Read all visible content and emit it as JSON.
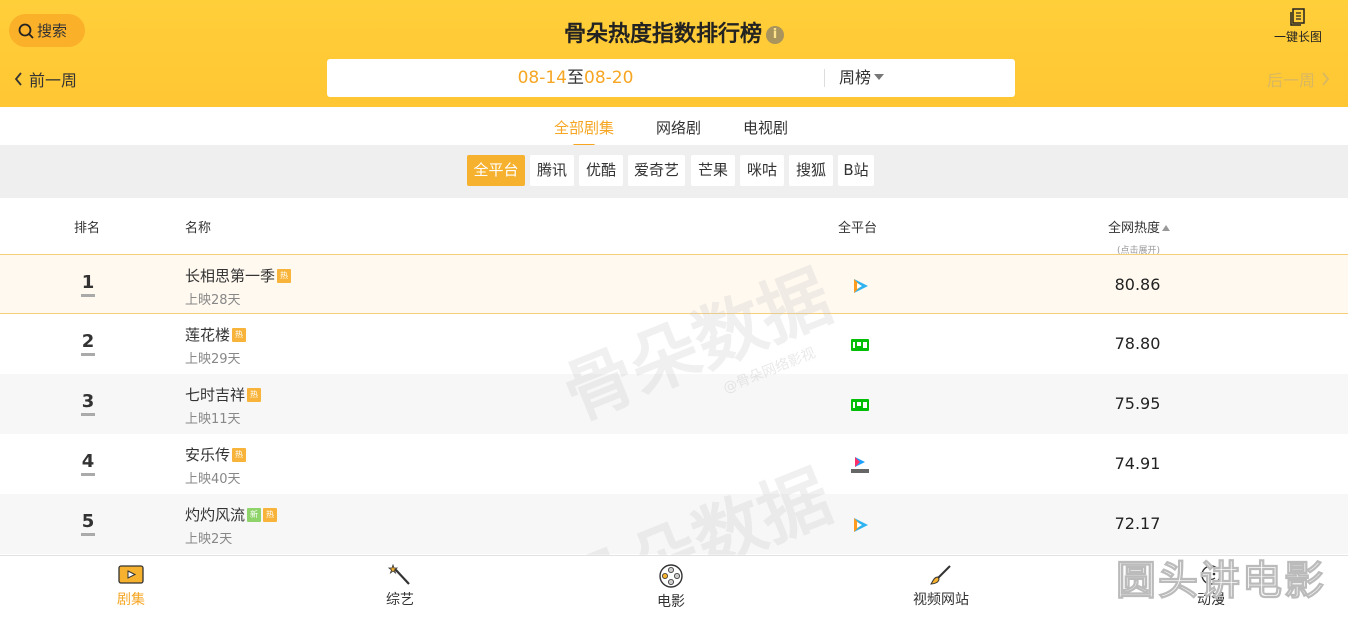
{
  "header": {
    "search_label": "搜索",
    "title": "骨朵热度指数排行榜",
    "info_icon": "info-icon",
    "long_image_label": "一键长图",
    "prev_week": "前一周",
    "next_week": "后一周",
    "date_start": "08-14",
    "date_sep": "至",
    "date_end": "08-20",
    "period_select": "周榜"
  },
  "category_tabs": [
    {
      "label": "全部剧集",
      "active": true
    },
    {
      "label": "网络剧",
      "active": false
    },
    {
      "label": "电视剧",
      "active": false
    }
  ],
  "platforms": [
    {
      "label": "全平台",
      "active": true
    },
    {
      "label": "腾讯"
    },
    {
      "label": "优酷"
    },
    {
      "label": "爱奇艺"
    },
    {
      "label": "芒果"
    },
    {
      "label": "咪咕"
    },
    {
      "label": "搜狐"
    },
    {
      "label": "B站"
    }
  ],
  "table": {
    "col_rank": "排名",
    "col_name": "名称",
    "col_platform": "全平台",
    "col_heat": "全网热度",
    "col_heat_sub": "(点击展开)",
    "rows": [
      {
        "rank": "1",
        "name": "长相思第一季",
        "badges": [
          "热"
        ],
        "days": "上映28天",
        "platform": "tencent-icon",
        "score": "80.86"
      },
      {
        "rank": "2",
        "name": "莲花楼",
        "badges": [
          "热"
        ],
        "days": "上映29天",
        "platform": "iqiyi-icon",
        "score": "78.80"
      },
      {
        "rank": "3",
        "name": "七时吉祥",
        "badges": [
          "热"
        ],
        "days": "上映11天",
        "platform": "iqiyi-icon",
        "score": "75.95"
      },
      {
        "rank": "4",
        "name": "安乐传",
        "badges": [
          "热"
        ],
        "days": "上映40天",
        "platform": "youku-icon",
        "score": "74.91"
      },
      {
        "rank": "5",
        "name": "灼灼风流",
        "badges": [
          "新",
          "热"
        ],
        "days": "上映2天",
        "platform": "tencent-icon",
        "score": "72.17"
      }
    ]
  },
  "watermark": {
    "text": "骨朵数据",
    "sub": "@骨朵网络影视"
  },
  "bottom_nav": [
    {
      "label": "剧集",
      "icon": "tv-icon",
      "active": true
    },
    {
      "label": "综艺",
      "icon": "magic-wand-icon"
    },
    {
      "label": "电影",
      "icon": "film-reel-icon"
    },
    {
      "label": "视频网站",
      "icon": "brush-icon"
    },
    {
      "label": "动漫",
      "icon": "anime-icon"
    }
  ],
  "corner_watermark": "圆头讲电影",
  "colors": {
    "accent": "#f6a623",
    "header_bg": "#ffcc38"
  }
}
